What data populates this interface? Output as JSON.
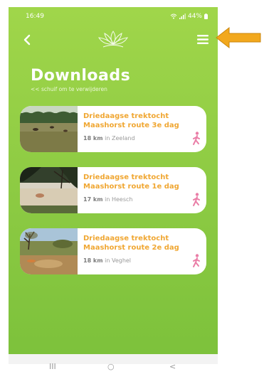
{
  "status_bar": {
    "time": "16:49",
    "battery": "44%",
    "icons": [
      "image-icon",
      "wifi-icon",
      "signal-icon",
      "battery-icon"
    ]
  },
  "header": {
    "back_icon": "chevron-left-icon",
    "logo_icon": "lotus-logo-icon",
    "menu_icon": "hamburger-menu-icon"
  },
  "page": {
    "title": "Downloads",
    "hint": "<< schuif om te verwijderen"
  },
  "downloads": [
    {
      "title": "Driedaagse trektocht Maashorst route 3e dag",
      "distance": "18 km",
      "location": "in Zeeland",
      "icon": "walking-person-icon"
    },
    {
      "title": "Driedaagse trektocht Maashorst route 1e dag",
      "distance": "17 km",
      "location": "in Heesch",
      "icon": "walking-person-icon"
    },
    {
      "title": "Driedaagse trektocht Maashorst route 2e dag",
      "distance": "18 km",
      "location": "in Veghel",
      "icon": "walking-person-icon"
    }
  ],
  "nav_bar": {
    "recents_glyph": "III",
    "home_glyph": "○",
    "back_glyph": "<"
  },
  "colors": {
    "background_green": "#8fcc44",
    "title_orange": "#f0a733",
    "walk_icon_pink": "#ea7ea7",
    "annotation_arrow": "#f2a81d"
  }
}
